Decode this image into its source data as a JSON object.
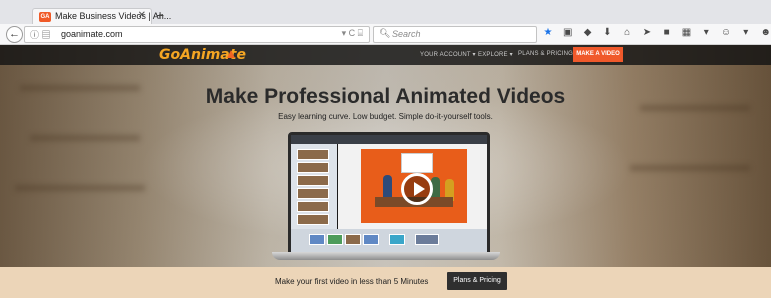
{
  "browser": {
    "tab": {
      "title": "Make Business Videos | An...",
      "favicon": "GA",
      "close": "✕"
    },
    "new_tab": "+",
    "back": "←",
    "url": "goanimate.com",
    "url_icons": "ⓘ ▤",
    "url_right": "▾ C   ⌸",
    "search_placeholder": "Search",
    "toolbar_icons": [
      "★",
      "▣",
      "◆",
      "⬇",
      "⌂",
      "➤",
      "■",
      "▦",
      "▾",
      "☺",
      "▾",
      "☻",
      "☰"
    ]
  },
  "site": {
    "logo": "GoAnimate",
    "nav": {
      "account": "YOUR ACCOUNT ▾",
      "explore": "EXPLORE ▾",
      "plans": "PLANS & PRICING",
      "make_video": "MAKE A VIDEO"
    },
    "hero": {
      "headline": "Make Professional Animated Videos",
      "subline": "Easy learning curve. Low budget. Simple do-it-yourself tools."
    },
    "cta": {
      "text": "Make your first video in less than 5 Minutes",
      "button": "Plans & Pricing"
    }
  },
  "colors": {
    "accent": "#f0592b",
    "logo": "#f5a623",
    "cta_band": "#ecd5b8"
  }
}
